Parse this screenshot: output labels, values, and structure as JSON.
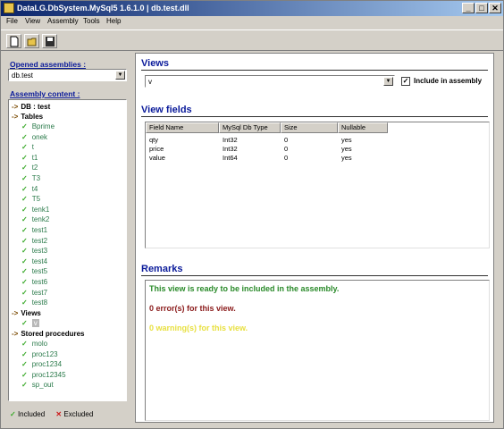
{
  "window": {
    "title": "DataLG.DbSystem.MySql5 1.6.1.0 | db.test.dll",
    "minimize": "_",
    "maximize": "□",
    "close": "✕"
  },
  "menu": [
    "File",
    "View",
    "Assembly",
    "Tools",
    "Help"
  ],
  "toolbar": {
    "new_icon": "new-file-icon",
    "open_icon": "open-folder-icon",
    "save_icon": "save-disk-icon"
  },
  "left": {
    "opened_label": "Opened assemblies :",
    "opened_value": "db.test",
    "content_label": "Assembly content :",
    "tree": {
      "db": "DB : test",
      "tables_label": "Tables",
      "tables": [
        "Bprime",
        "onek",
        "t",
        "t1",
        "t2",
        "T3",
        "t4",
        "T5",
        "tenk1",
        "tenk2",
        "test1",
        "test2",
        "test3",
        "test4",
        "test5",
        "test6",
        "test7",
        "test8"
      ],
      "views_label": "Views",
      "views": [
        "v"
      ],
      "procs_label": "Stored procedures",
      "procs": [
        "molo",
        "proc123",
        "proc1234",
        "proc12345",
        "sp_out"
      ]
    },
    "legend_included": "Included",
    "legend_excluded": "Excluded"
  },
  "right": {
    "views_heading": "Views",
    "view_select_value": "v",
    "include_label": "Include in assembly",
    "include_checked": true,
    "fields_heading": "View fields",
    "columns": [
      "Field Name",
      "MySql Db Type",
      "Size",
      "Nullable"
    ],
    "rows": [
      [
        "qty",
        "Int32",
        "0",
        "yes"
      ],
      [
        "price",
        "Int32",
        "0",
        "yes"
      ],
      [
        "value",
        "Int64",
        "0",
        "yes"
      ]
    ],
    "remarks_heading": "Remarks",
    "remarks": {
      "ready": "This view is ready to be included in the assembly.",
      "errors": "0 error(s) for this view.",
      "warnings": "0 warning(s) for this view."
    }
  },
  "colors": {
    "heading": "#0a1a9a",
    "ready": "#2a8a2a",
    "errors": "#8a1a1a",
    "warnings": "#e8e040"
  }
}
